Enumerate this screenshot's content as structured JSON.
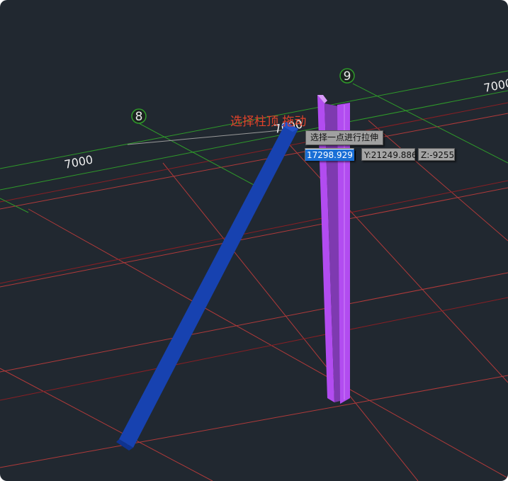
{
  "scene": {
    "grid_axes": [
      {
        "label": "8"
      },
      {
        "label": "9"
      }
    ],
    "dimensions": [
      {
        "text": "7000"
      },
      {
        "text": "7000"
      },
      {
        "text": "7000"
      }
    ],
    "prompt_text": "选择柱顶 拖动",
    "tooltip_text": "选择一点进行拉伸",
    "coords": {
      "x_value": "17298.929",
      "y_text": "Y:21249.886",
      "z_text": "Z:-9255"
    },
    "colors": {
      "background": "#212830",
      "grid_line_green": "#2f9a2a",
      "grid_line_red": "#b03a3a",
      "grid_line_darkred": "#8a1f24",
      "column_selected": "#b24cf0",
      "column_inclined": "#1742b0",
      "prompt_text": "#e2432a"
    }
  }
}
